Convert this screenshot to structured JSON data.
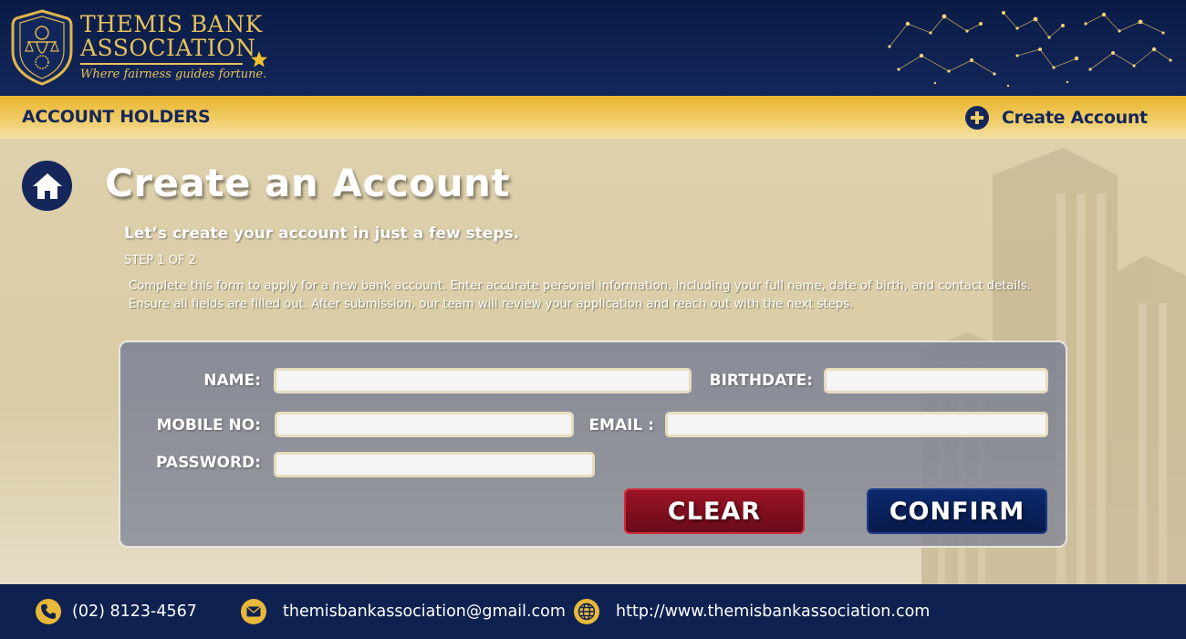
{
  "brand": {
    "line1": "THEMIS BANK",
    "line2": "ASSOCIATION",
    "tagline": "Where fairness guides fortune."
  },
  "nav": {
    "title": "ACCOUNT HOLDERS",
    "create_account_label": "Create Account"
  },
  "page": {
    "title": "Create an Account",
    "subtitle": "Let’s create your account in just a few steps.",
    "step": "STEP 1 OF 2",
    "description": "Complete this form to apply for a new bank account. Enter accurate personal information, including your full name, date of birth, and contact details. Ensure all fields are filled out. After submission, our team will review your application and reach out with the next steps."
  },
  "form": {
    "name_label": "NAME:",
    "birthdate_label": "BIRTHDATE:",
    "mobile_label": "MOBILE NO:",
    "email_label": "EMAIL :",
    "password_label": "PASSWORD:",
    "name_value": "",
    "birthdate_value": "",
    "mobile_value": "",
    "email_value": "",
    "password_value": "",
    "clear_label": "CLEAR",
    "confirm_label": "CONFIRM"
  },
  "footer": {
    "phone": "(02) 8123-4567",
    "email": "themisbankassociation@gmail.com",
    "website": "http://www.themisbankassociation.com"
  },
  "colors": {
    "navy": "#0e2150",
    "gold": "#e8b83a",
    "clear_red": "#8a1022",
    "confirm_navy": "#0a2260"
  },
  "icons": [
    "shield-logo-icon",
    "star-icon",
    "constellation-icon",
    "plus-icon",
    "home-icon",
    "phone-icon",
    "mail-icon",
    "globe-icon"
  ]
}
